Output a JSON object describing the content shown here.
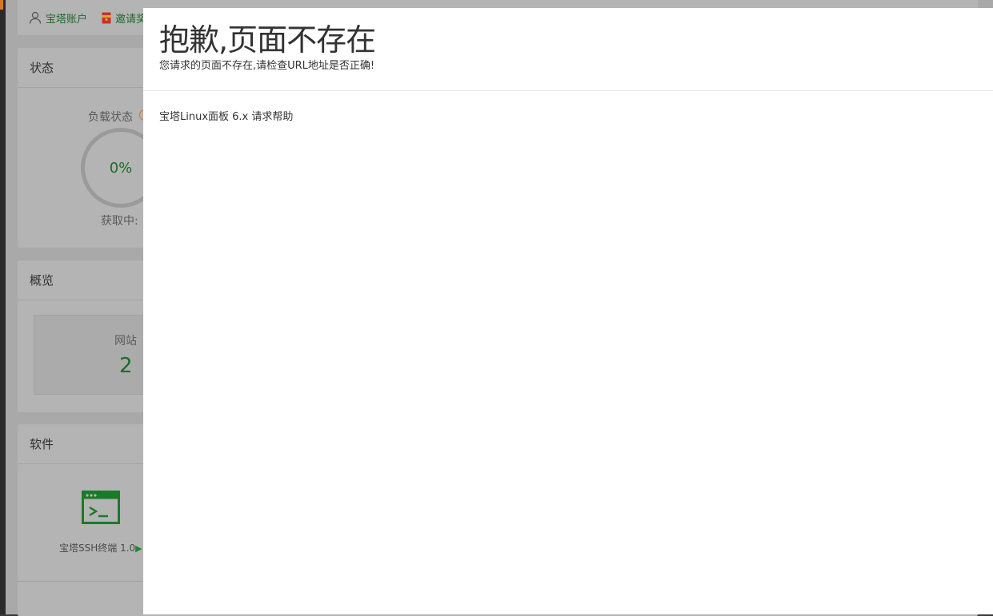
{
  "topbar": {
    "account_label": "宝塔账户",
    "invite_label": "邀请奖"
  },
  "status": {
    "title": "状态",
    "load_label": "负载状态",
    "load_value": "0%",
    "fetching_label": "获取中:"
  },
  "overview": {
    "title": "概览",
    "site_label": "网站",
    "site_count": "2"
  },
  "software": {
    "title": "软件",
    "ssh_label": "宝塔SSH终端 1.0",
    "ssh_arrow": "▶"
  },
  "modal": {
    "title": "抱歉,页面不存在",
    "subtitle": "您请求的页面不存在,请检查URL地址是否正确!",
    "footer": "宝塔Linux面板 6.x 请求帮助"
  },
  "colors": {
    "accent_green": "#1b6b2a",
    "warn_orange": "#d27a1e"
  }
}
